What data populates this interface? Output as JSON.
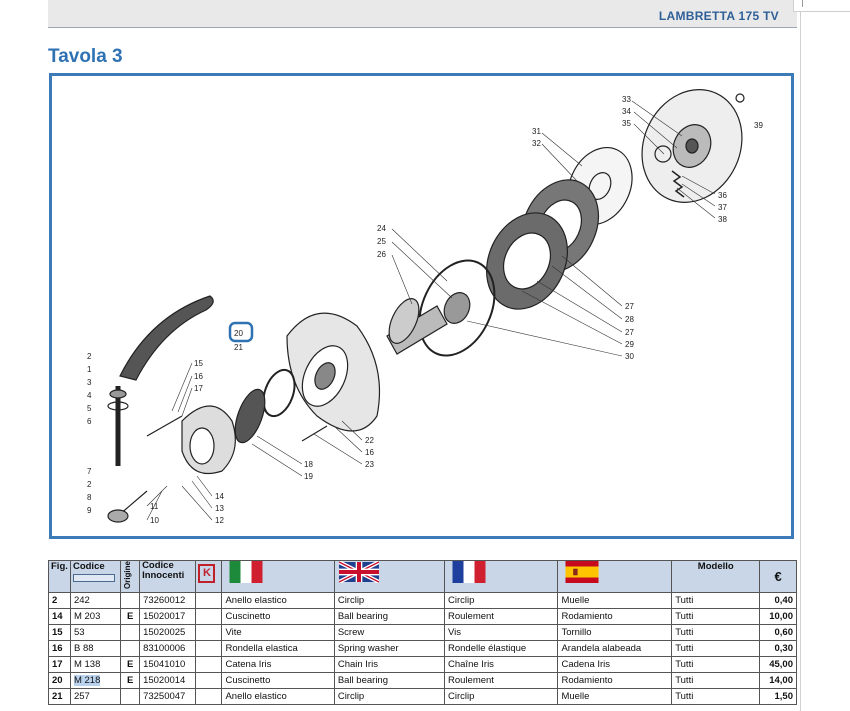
{
  "header": {
    "model": "LAMBRETTA 175 TV"
  },
  "page": {
    "title": "Tavola 3"
  },
  "figure": {
    "callouts": [
      "33",
      "34",
      "35",
      "39",
      "31",
      "32",
      "36",
      "37",
      "38",
      "24",
      "25",
      "26",
      "27",
      "28",
      "27",
      "29",
      "30",
      "20",
      "21",
      "22",
      "16",
      "23",
      "18",
      "19",
      "15",
      "16",
      "17",
      "14",
      "13",
      "12",
      "11",
      "10",
      "2",
      "1",
      "3",
      "4",
      "5",
      "6",
      "7",
      "2",
      "8",
      "9"
    ]
  },
  "table": {
    "headers": {
      "fig": "Fig.",
      "codice": "Codice",
      "origine": "Origine",
      "codice_innocenti": "Codice Innocenti",
      "k": "K",
      "modello": "Modello",
      "euro": "€"
    },
    "rows": [
      {
        "fig": "2",
        "codice": "242",
        "origine": "",
        "innocenti": "73260012",
        "it": "Anello elastico",
        "en": "Circlip",
        "fr": "Circlip",
        "es": "Muelle",
        "modello": "Tutti",
        "prezzo": "0,40"
      },
      {
        "fig": "14",
        "codice": "M 203",
        "origine": "E",
        "innocenti": "15020017",
        "it": "Cuscinetto",
        "en": "Ball bearing",
        "fr": "Roulement",
        "es": "Rodamiento",
        "modello": "Tutti",
        "prezzo": "10,00"
      },
      {
        "fig": "15",
        "codice": "53",
        "origine": "",
        "innocenti": "15020025",
        "it": "Vite",
        "en": "Screw",
        "fr": "Vis",
        "es": "Tornillo",
        "modello": "Tutti",
        "prezzo": "0,60"
      },
      {
        "fig": "16",
        "codice": "B 88",
        "origine": "",
        "innocenti": "83100006",
        "it": "Rondella elastica",
        "en": "Spring washer",
        "fr": "Rondelle élastique",
        "es": "Arandela alabeada",
        "modello": "Tutti",
        "prezzo": "0,30"
      },
      {
        "fig": "17",
        "codice": "M 138",
        "origine": "E",
        "innocenti": "15041010",
        "it": "Catena Iris",
        "en": "Chain Iris",
        "fr": "Chaîne Iris",
        "es": "Cadena Iris",
        "modello": "Tutti",
        "prezzo": "45,00"
      },
      {
        "fig": "20",
        "codice": "M 218",
        "origine": "E",
        "innocenti": "15020014",
        "it": "Cuscinetto",
        "en": "Ball bearing",
        "fr": "Roulement",
        "es": "Rodamiento",
        "modello": "Tutti",
        "prezzo": "14,00"
      },
      {
        "fig": "21",
        "codice": "257",
        "origine": "",
        "innocenti": "73250047",
        "it": "Anello elastico",
        "en": "Circlip",
        "fr": "Circlip",
        "es": "Muelle",
        "modello": "Tutti",
        "prezzo": "1,50"
      }
    ]
  },
  "colors": {
    "accent": "#2f72b4",
    "frame": "#3d7ab8",
    "header_fill": "#c8d6e8",
    "highlight": "#b9d3ef"
  }
}
